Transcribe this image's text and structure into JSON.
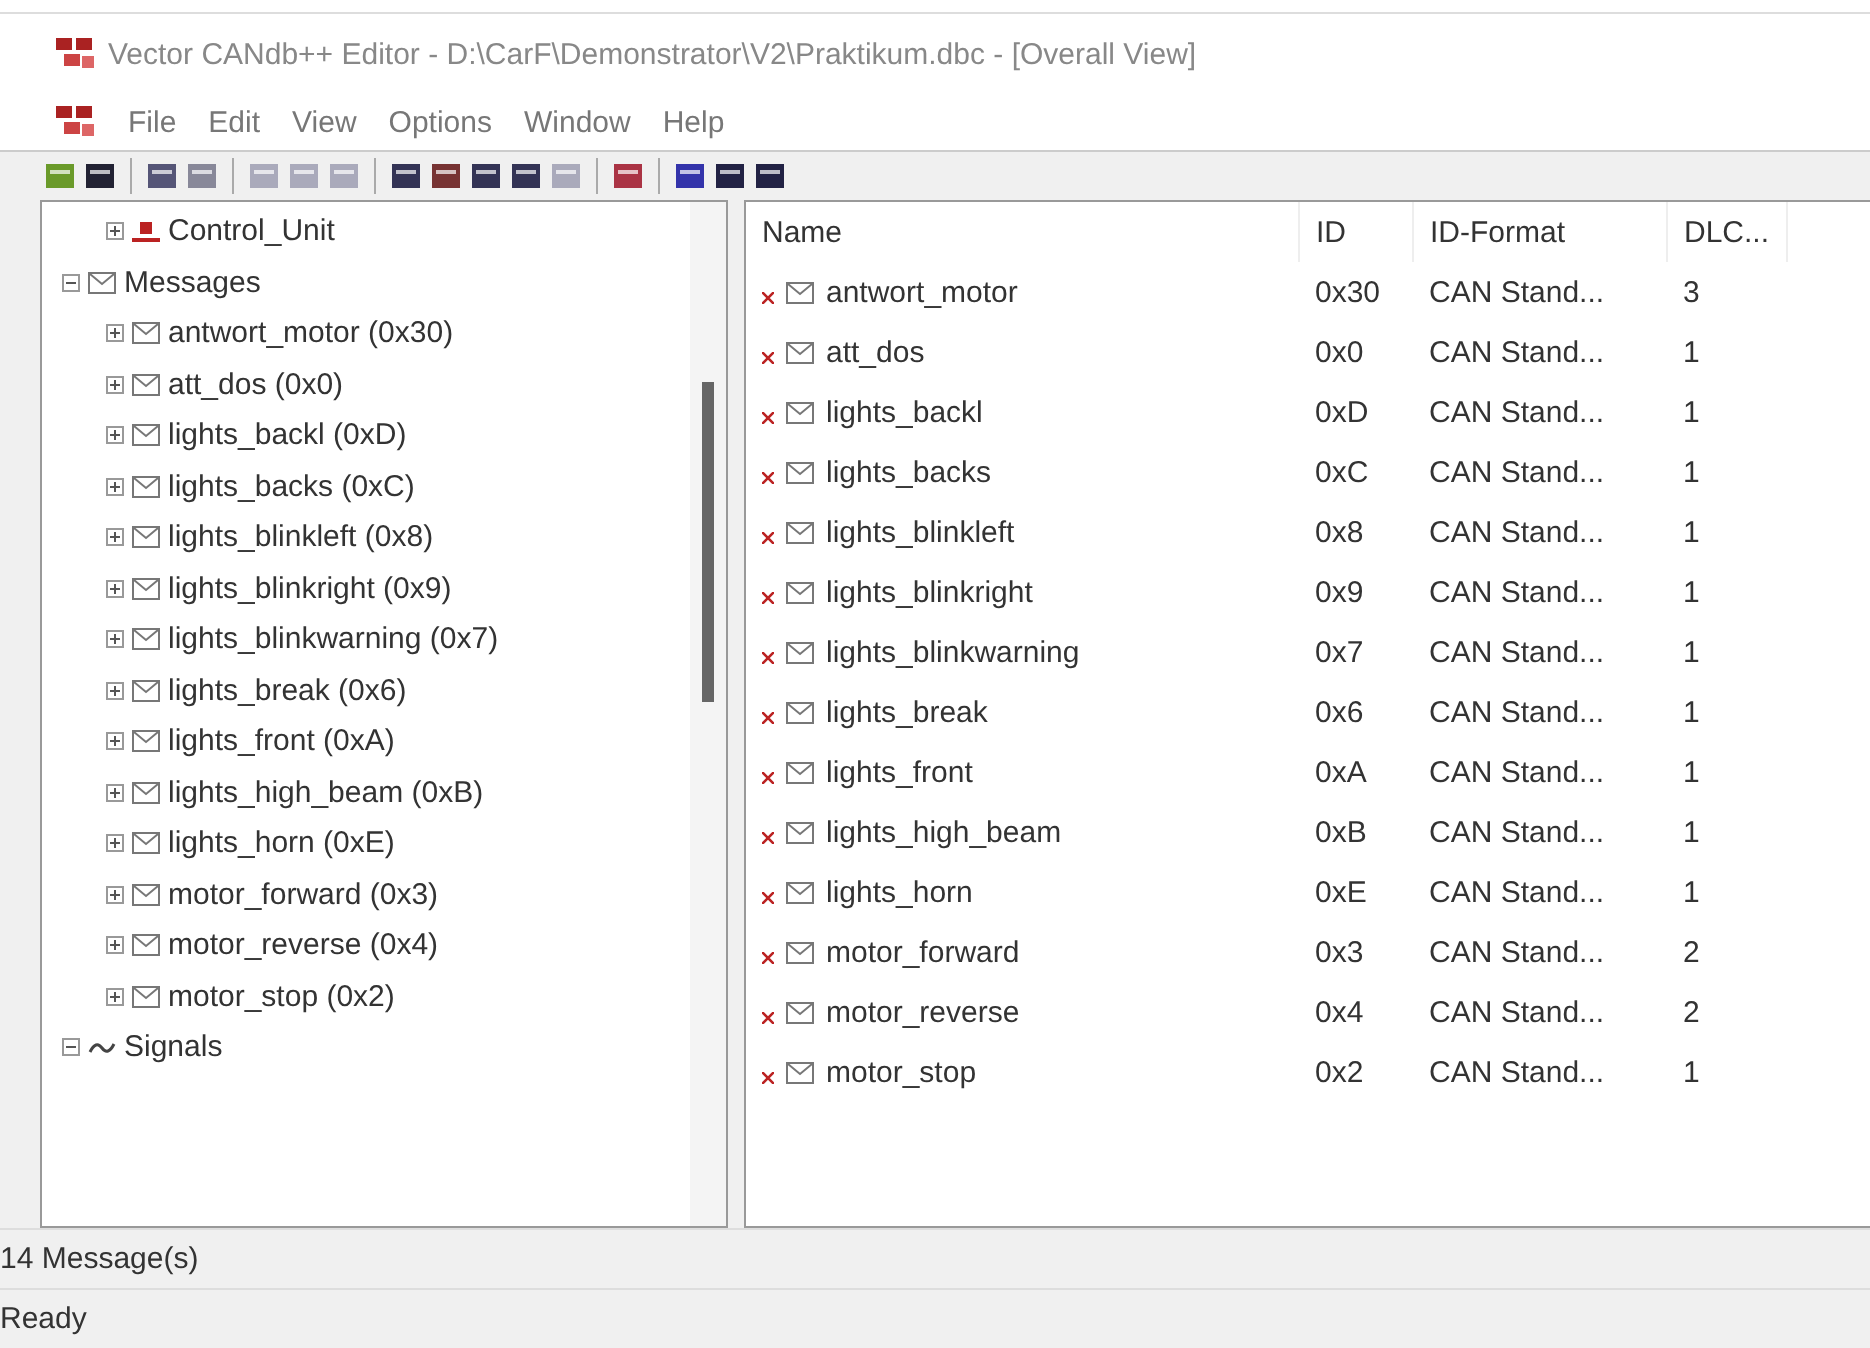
{
  "window": {
    "title": "Vector CANdb++ Editor - D:\\CarF\\Demonstrator\\V2\\Praktikum.dbc - [Overall View]"
  },
  "menu": [
    "File",
    "Edit",
    "View",
    "Options",
    "Window",
    "Help"
  ],
  "tree": [
    {
      "label": "Control_Unit",
      "kind": "ecu",
      "expanded": false
    },
    {
      "label": "Messages",
      "kind": "message",
      "expanded": true,
      "children": [
        {
          "label": "antwort_motor (0x30)",
          "kind": "message",
          "expanded": false
        },
        {
          "label": "att_dos (0x0)",
          "kind": "message",
          "expanded": false
        },
        {
          "label": "lights_backl (0xD)",
          "kind": "message",
          "expanded": false
        },
        {
          "label": "lights_backs (0xC)",
          "kind": "message",
          "expanded": false
        },
        {
          "label": "lights_blinkleft (0x8)",
          "kind": "message",
          "expanded": false
        },
        {
          "label": "lights_blinkright (0x9)",
          "kind": "message",
          "expanded": false
        },
        {
          "label": "lights_blinkwarning (0x7)",
          "kind": "message",
          "expanded": false
        },
        {
          "label": "lights_break (0x6)",
          "kind": "message",
          "expanded": false
        },
        {
          "label": "lights_front (0xA)",
          "kind": "message",
          "expanded": false
        },
        {
          "label": "lights_high_beam (0xB)",
          "kind": "message",
          "expanded": false
        },
        {
          "label": "lights_horn (0xE)",
          "kind": "message",
          "expanded": false
        },
        {
          "label": "motor_forward (0x3)",
          "kind": "message",
          "expanded": false
        },
        {
          "label": "motor_reverse (0x4)",
          "kind": "message",
          "expanded": false
        },
        {
          "label": "motor_stop (0x2)",
          "kind": "message",
          "expanded": false
        }
      ]
    },
    {
      "label": "Signals",
      "kind": "signal",
      "expanded": true
    }
  ],
  "table": {
    "columns": [
      "Name",
      "ID",
      "ID-Format",
      "DLC..."
    ],
    "rows": [
      {
        "name": "antwort_motor",
        "id": "0x30",
        "format": "CAN Stand...",
        "dlc": "3"
      },
      {
        "name": "att_dos",
        "id": "0x0",
        "format": "CAN Stand...",
        "dlc": "1"
      },
      {
        "name": "lights_backl",
        "id": "0xD",
        "format": "CAN Stand...",
        "dlc": "1"
      },
      {
        "name": "lights_backs",
        "id": "0xC",
        "format": "CAN Stand...",
        "dlc": "1"
      },
      {
        "name": "lights_blinkleft",
        "id": "0x8",
        "format": "CAN Stand...",
        "dlc": "1"
      },
      {
        "name": "lights_blinkright",
        "id": "0x9",
        "format": "CAN Stand...",
        "dlc": "1"
      },
      {
        "name": "lights_blinkwarning",
        "id": "0x7",
        "format": "CAN Stand...",
        "dlc": "1"
      },
      {
        "name": "lights_break",
        "id": "0x6",
        "format": "CAN Stand...",
        "dlc": "1"
      },
      {
        "name": "lights_front",
        "id": "0xA",
        "format": "CAN Stand...",
        "dlc": "1"
      },
      {
        "name": "lights_high_beam",
        "id": "0xB",
        "format": "CAN Stand...",
        "dlc": "1"
      },
      {
        "name": "lights_horn",
        "id": "0xE",
        "format": "CAN Stand...",
        "dlc": "1"
      },
      {
        "name": "motor_forward",
        "id": "0x3",
        "format": "CAN Stand...",
        "dlc": "2"
      },
      {
        "name": "motor_reverse",
        "id": "0x4",
        "format": "CAN Stand...",
        "dlc": "2"
      },
      {
        "name": "motor_stop",
        "id": "0x2",
        "format": "CAN Stand...",
        "dlc": "1"
      }
    ]
  },
  "status_bar": {
    "count": "14 Message(s)",
    "state": "Ready"
  }
}
